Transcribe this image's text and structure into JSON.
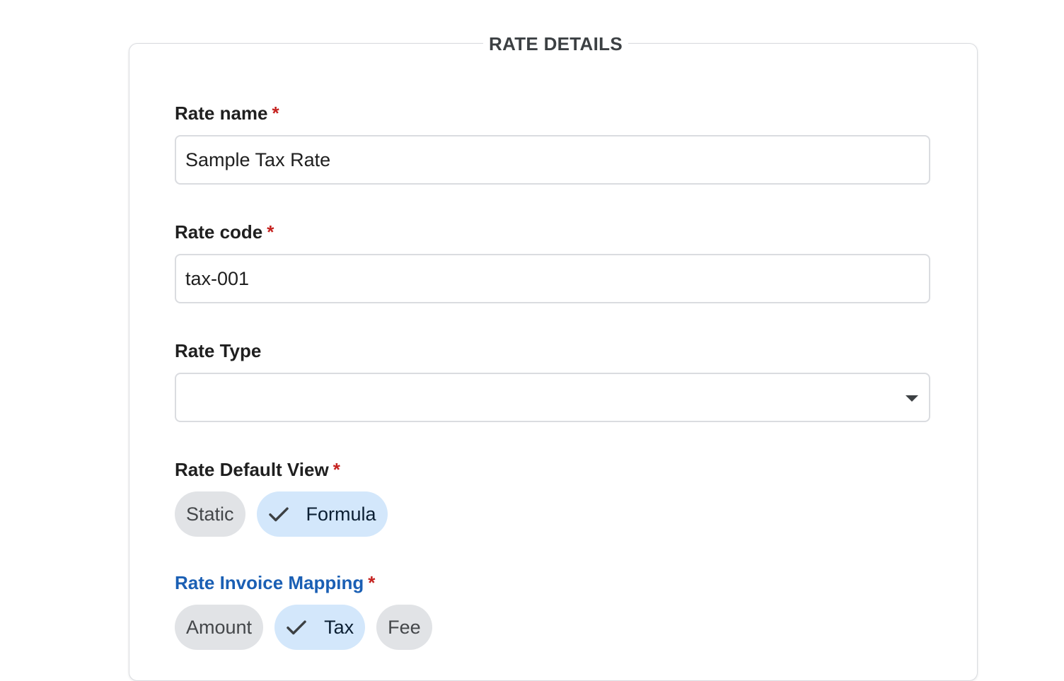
{
  "section": {
    "title": "RATE DETAILS"
  },
  "fields": {
    "rate_name": {
      "label": "Rate name",
      "required": "*",
      "value": "Sample Tax Rate"
    },
    "rate_code": {
      "label": "Rate code",
      "required": "*",
      "value": "tax-001"
    },
    "rate_type": {
      "label": "Rate Type",
      "value": "",
      "icon": "chevron-down-icon"
    },
    "rate_default_view": {
      "label": "Rate Default View",
      "required": "*",
      "options": [
        {
          "label": "Static",
          "selected": false
        },
        {
          "label": "Formula",
          "selected": true
        }
      ]
    },
    "rate_invoice_mapping": {
      "label": "Rate Invoice Mapping",
      "required": "*",
      "label_color": "#1a5fb4",
      "options": [
        {
          "label": "Amount",
          "selected": false
        },
        {
          "label": "Tax",
          "selected": true
        },
        {
          "label": "Fee",
          "selected": false
        }
      ]
    }
  },
  "colors": {
    "required": "#c5221f",
    "chip_selected": "#d3e7fb",
    "chip_default": "#e1e3e6",
    "border": "#dadce0"
  }
}
